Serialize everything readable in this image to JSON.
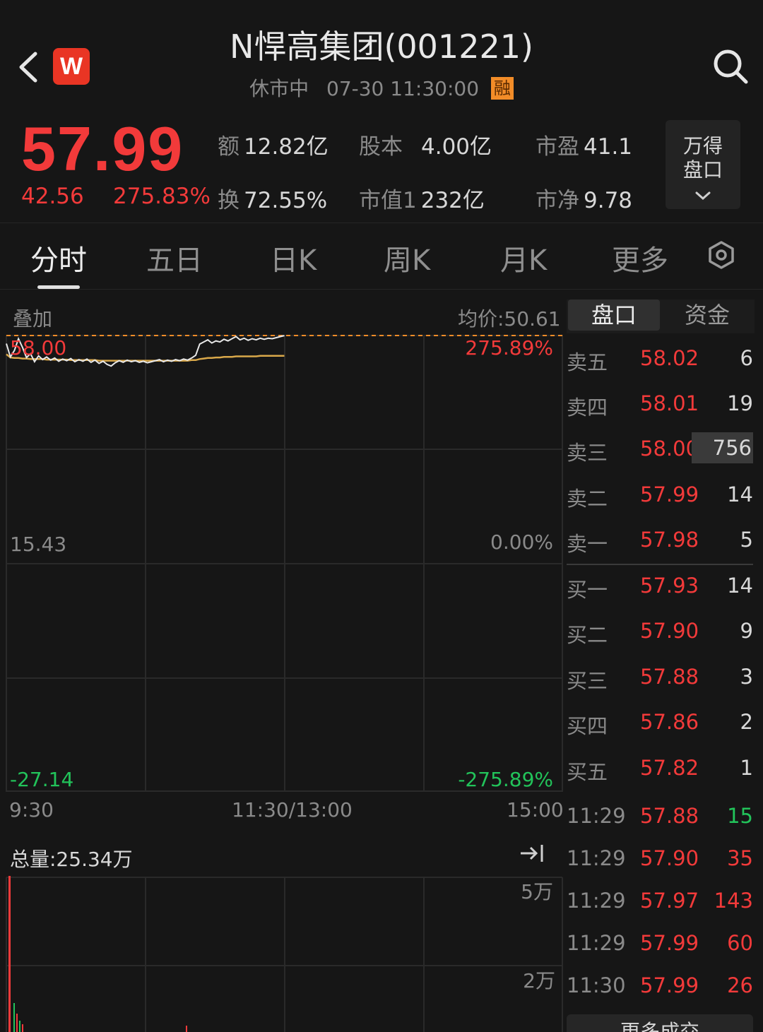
{
  "header": {
    "title": "N悍高集团(001221)",
    "status": "休市中",
    "datetime": "07-30 11:30:00",
    "margin_badge": "融",
    "logo_letter": "W"
  },
  "quote": {
    "price": "57.99",
    "change": "42.56",
    "change_pct": "275.83%",
    "stats": [
      {
        "label": "额",
        "value": "12.82亿"
      },
      {
        "label": "股本",
        "value": "4.00亿"
      },
      {
        "label": "市盈",
        "value": "41.1"
      },
      {
        "label": "换",
        "value": "72.55%"
      },
      {
        "label": "市值1",
        "value": "232亿"
      },
      {
        "label": "市净",
        "value": "9.78"
      }
    ],
    "wande_line1": "万得",
    "wande_line2": "盘口"
  },
  "tabs": [
    "分时",
    "五日",
    "日K",
    "周K",
    "月K",
    "更多"
  ],
  "active_tab": 0,
  "chart": {
    "overlay_label": "叠加",
    "avg_price": "均价:50.61",
    "y_labels": {
      "top": "58.00",
      "mid": "15.43",
      "bottom": "-27.14"
    },
    "pct_labels": {
      "top": "275.89%",
      "mid": "0.00%",
      "bottom": "-275.89%"
    },
    "time_labels": [
      "9:30",
      "11:30/13:00",
      "15:00"
    ],
    "price_range": [
      -27.14,
      58.0
    ],
    "colors": {
      "price_line": "#e8e8e8",
      "avg_line": "#d9a84a",
      "ref_line": "#f28c28"
    },
    "price_series": [
      56.5,
      54,
      55.2,
      57.4,
      55.8,
      53.9,
      54.6,
      53.1,
      54.2,
      53.5,
      54.0,
      53.4,
      53.8,
      53.2,
      53.6,
      53.3,
      53.7,
      53.1,
      53.5,
      53.2,
      53.6,
      53.0,
      53.4,
      52.8,
      53.2,
      52.6,
      52.3,
      52.9,
      53.3,
      53.0,
      53.4,
      53.1,
      53.3,
      53.0,
      53.2,
      52.9,
      53.1,
      53.3,
      53.5,
      53.1,
      53.4,
      53.2,
      53.5,
      53.3,
      53.6,
      53.4,
      53.8,
      54.3,
      56.4,
      56.8,
      57.2,
      56.6,
      57.0,
      56.8,
      57.3,
      57.0,
      57.4,
      57.8,
      57.2,
      57.5,
      57.1,
      57.4,
      57.2,
      57.5,
      57.3,
      57.5,
      57.4,
      57.6,
      57.8,
      57.99
    ],
    "avg_series": [
      54.5,
      53.9,
      53.8,
      53.8,
      53.7,
      53.7,
      53.6,
      53.6,
      53.6,
      53.6,
      53.5,
      53.5,
      53.5,
      53.5,
      53.5,
      53.5,
      53.4,
      53.4,
      53.4,
      53.4,
      53.4,
      53.4,
      53.4,
      53.3,
      53.3,
      53.3,
      53.3,
      53.3,
      53.3,
      53.3,
      53.3,
      53.3,
      53.3,
      53.3,
      53.3,
      53.3,
      53.3,
      53.3,
      53.3,
      53.3,
      53.3,
      53.3,
      53.3,
      53.3,
      53.3,
      53.3,
      53.4,
      53.4,
      53.6,
      53.7,
      53.8,
      53.8,
      53.9,
      53.9,
      54.0,
      54.0,
      54.0,
      54.1,
      54.1,
      54.1,
      54.1,
      54.1,
      54.1,
      54.2,
      54.2,
      54.2,
      54.2,
      54.2,
      54.2,
      54.2
    ]
  },
  "volume": {
    "total_label": "总量:25.34万",
    "y_labels": [
      "5万",
      "2万"
    ]
  },
  "orderbook": {
    "tabs": [
      "盘口",
      "资金"
    ],
    "active_tab": 0,
    "asks": [
      {
        "name": "卖五",
        "price": "58.02",
        "qty": "6"
      },
      {
        "name": "卖四",
        "price": "58.01",
        "qty": "19"
      },
      {
        "name": "卖三",
        "price": "58.00",
        "qty": "756"
      },
      {
        "name": "卖二",
        "price": "57.99",
        "qty": "14"
      },
      {
        "name": "卖一",
        "price": "57.98",
        "qty": "5"
      }
    ],
    "bids": [
      {
        "name": "买一",
        "price": "57.93",
        "qty": "14"
      },
      {
        "name": "买二",
        "price": "57.90",
        "qty": "9"
      },
      {
        "name": "买三",
        "price": "57.88",
        "qty": "3"
      },
      {
        "name": "买四",
        "price": "57.86",
        "qty": "2"
      },
      {
        "name": "买五",
        "price": "57.82",
        "qty": "1"
      }
    ]
  },
  "trades": [
    {
      "time": "11:29",
      "price": "57.88",
      "qty": "15",
      "dir": "down"
    },
    {
      "time": "11:29",
      "price": "57.90",
      "qty": "35",
      "dir": "up"
    },
    {
      "time": "11:29",
      "price": "57.97",
      "qty": "143",
      "dir": "up"
    },
    {
      "time": "11:29",
      "price": "57.99",
      "qty": "60",
      "dir": "up"
    },
    {
      "time": "11:30",
      "price": "57.99",
      "qty": "26",
      "dir": "up"
    }
  ],
  "more_trades_label": "更多成交"
}
